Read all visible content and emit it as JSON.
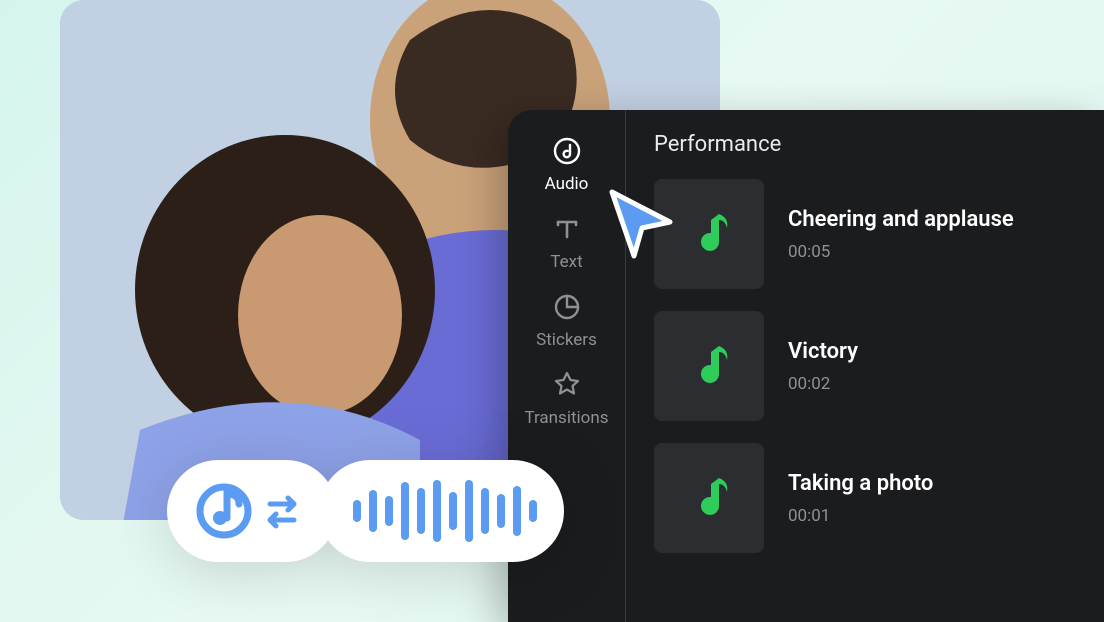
{
  "sidebar": {
    "items": [
      {
        "label": "Audio"
      },
      {
        "label": "Text"
      },
      {
        "label": "Stickers"
      },
      {
        "label": "Transitions"
      }
    ],
    "active_index": 0
  },
  "section_title": "Performance",
  "tracks": [
    {
      "title": "Cheering and applause",
      "duration": "00:05"
    },
    {
      "title": "Victory",
      "duration": "00:02"
    },
    {
      "title": "Taking a photo",
      "duration": "00:01"
    }
  ],
  "colors": {
    "accent_blue": "#5b9cf2",
    "note_green": "#2ecc5a",
    "panel_bg": "#1b1c1e",
    "thumb_bg": "#2c2d30"
  }
}
